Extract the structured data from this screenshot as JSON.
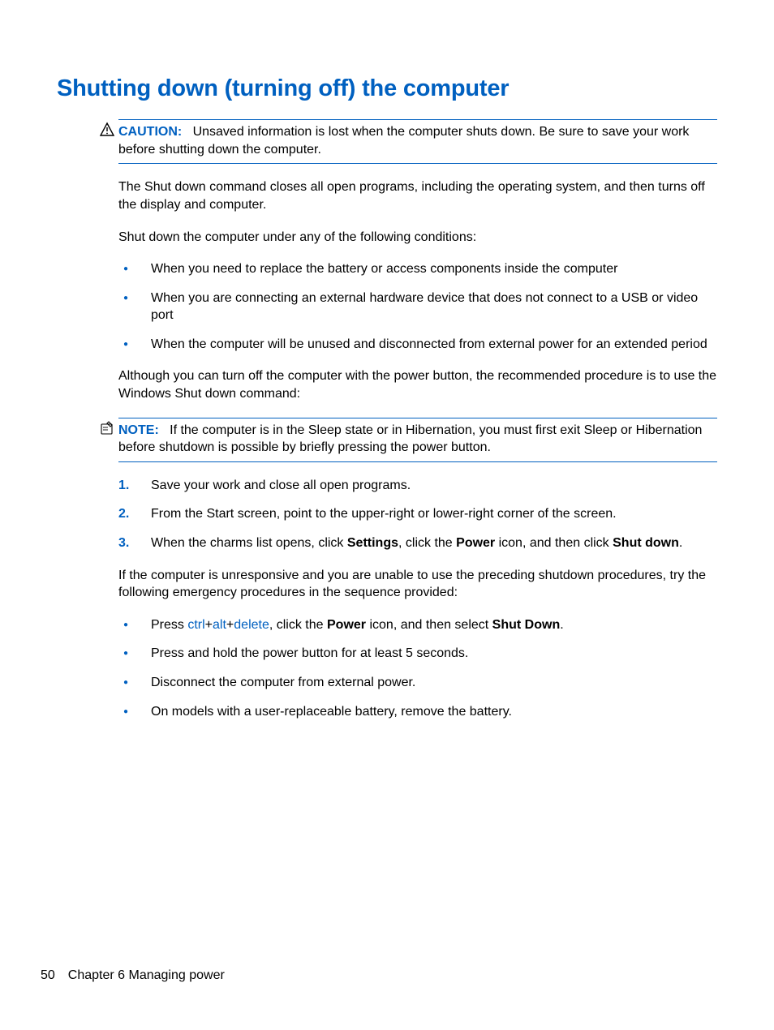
{
  "heading": "Shutting down (turning off) the computer",
  "caution": {
    "label": "CAUTION:",
    "text": "Unsaved information is lost when the computer shuts down. Be sure to save your work before shutting down the computer."
  },
  "para1": "The Shut down command closes all open programs, including the operating system, and then turns off the display and computer.",
  "para2": "Shut down the computer under any of the following conditions:",
  "conditions": [
    "When you need to replace the battery or access components inside the computer",
    "When you are connecting an external hardware device that does not connect to a USB or video port",
    "When the computer will be unused and disconnected from external power for an extended period"
  ],
  "para3": "Although you can turn off the computer with the power button, the recommended procedure is to use the Windows Shut down command:",
  "note": {
    "label": "NOTE:",
    "text": "If the computer is in the Sleep state or in Hibernation, you must first exit Sleep or Hibernation before shutdown is possible by briefly pressing the power button."
  },
  "steps": {
    "s1": "Save your work and close all open programs.",
    "s2": "From the Start screen, point to the upper-right or lower-right corner of the screen.",
    "s3_pre": "When the charms list opens, click ",
    "s3_b1": "Settings",
    "s3_mid1": ", click the ",
    "s3_b2": "Power",
    "s3_mid2": " icon, and then click ",
    "s3_b3": "Shut down",
    "s3_post": "."
  },
  "para4": "If the computer is unresponsive and you are unable to use the preceding shutdown procedures, try the following emergency procedures in the sequence provided:",
  "emergency": {
    "e1_pre": "Press ",
    "e1_k1": "ctrl",
    "e1_plus": "+",
    "e1_k2": "alt",
    "e1_k3": "delete",
    "e1_mid": ", click the ",
    "e1_b1": "Power",
    "e1_mid2": " icon, and then select ",
    "e1_b2": "Shut Down",
    "e1_post": ".",
    "e2": "Press and hold the power button for at least 5 seconds.",
    "e3": "Disconnect the computer from external power.",
    "e4": "On models with a user-replaceable battery, remove the battery."
  },
  "footer": {
    "page": "50",
    "chapter": "Chapter 6   Managing power"
  }
}
